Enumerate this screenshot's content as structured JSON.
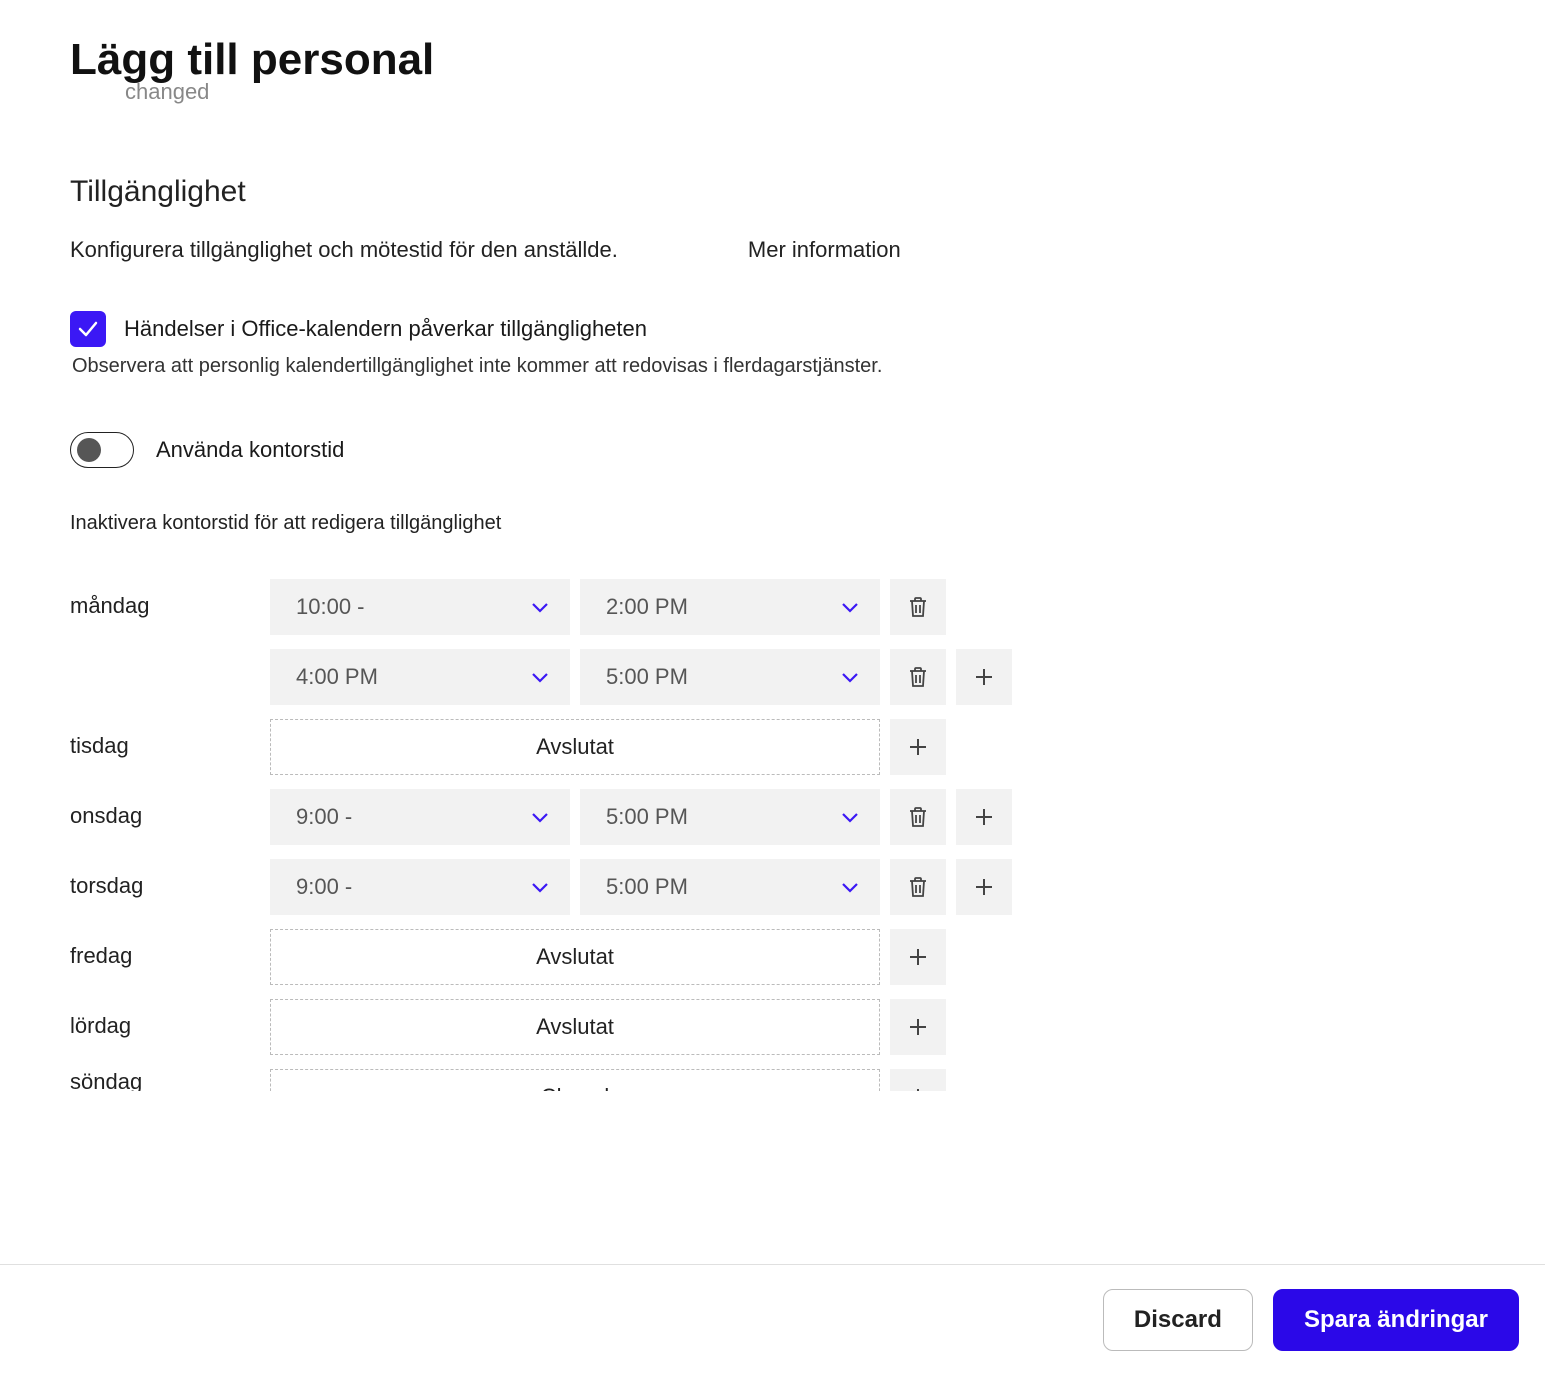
{
  "header": {
    "title": "Lägg till personal",
    "changed": "changed"
  },
  "availability": {
    "title": "Tillgänglighet",
    "description": "Konfigurera tillgänglighet och mötestid för den anställde.",
    "more_info": "Mer information",
    "checkbox_label": "Händelser i Office-kalendern påverkar tillgängligheten",
    "note": "Observera att personlig kalendertillgänglighet inte kommer att redovisas i flerdagarstjänster.",
    "toggle_label": "Använda kontorstid",
    "helper": "Inaktivera kontorstid för att redigera tillgänglighet"
  },
  "closed_label": "Avslutat",
  "sunday_closed": "Closed",
  "days": {
    "monday": {
      "label": "måndag",
      "ranges": [
        {
          "start": "10:00 -",
          "end": "2:00 PM"
        },
        {
          "start": "4:00 PM",
          "end": "5:00 PM"
        }
      ]
    },
    "tuesday": {
      "label": "tisdag"
    },
    "wednesday": {
      "label": "onsdag",
      "ranges": [
        {
          "start": "9:00 -",
          "end": "5:00 PM"
        }
      ]
    },
    "thursday": {
      "label": "torsdag",
      "ranges": [
        {
          "start": "9:00 -",
          "end": "5:00 PM"
        }
      ]
    },
    "friday": {
      "label": "fredag"
    },
    "saturday": {
      "label": "lördag"
    },
    "sunday": {
      "label": "söndag"
    }
  },
  "footer": {
    "discard": "Discard",
    "save": "Spara ändringar"
  }
}
